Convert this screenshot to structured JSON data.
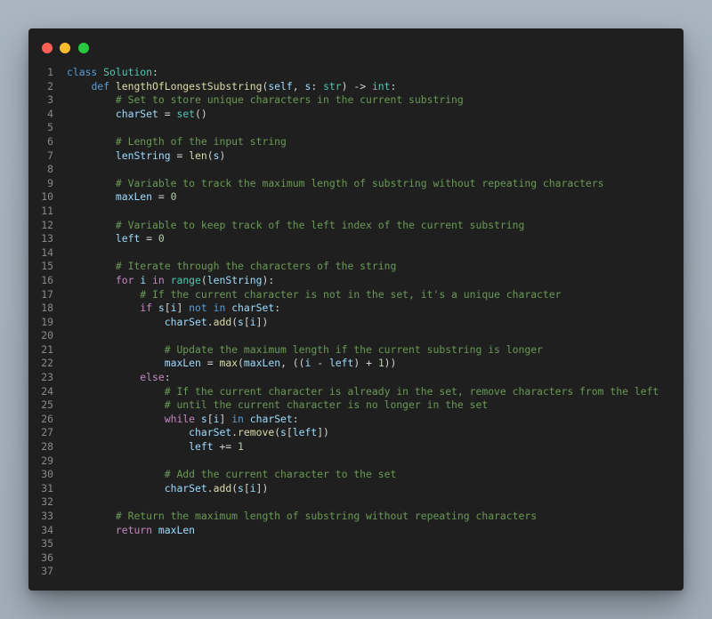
{
  "window": {
    "controls": [
      {
        "name": "close",
        "color": "#fe5f57"
      },
      {
        "name": "minimize",
        "color": "#febc2e"
      },
      {
        "name": "zoom",
        "color": "#28c840"
      }
    ]
  },
  "theme": {
    "default": "#d4d4d4",
    "kw": "#569cd6",
    "ctrl": "#c586c0",
    "cls": "#4ec9b0",
    "fn": "#dcdcaa",
    "var": "#9cdcfe",
    "num": "#b5cea8",
    "cmt": "#6a9955",
    "p": "#d4d4d4"
  },
  "code": {
    "lines": [
      [
        [
          "kw",
          "class"
        ],
        [
          "p",
          " "
        ],
        [
          "cls",
          "Solution"
        ],
        [
          "p",
          ":"
        ]
      ],
      [
        [
          "p",
          "    "
        ],
        [
          "kw",
          "def"
        ],
        [
          "p",
          " "
        ],
        [
          "fn",
          "lengthOfLongestSubstring"
        ],
        [
          "p",
          "("
        ],
        [
          "var",
          "self"
        ],
        [
          "p",
          ", "
        ],
        [
          "var",
          "s"
        ],
        [
          "p",
          ": "
        ],
        [
          "cls",
          "str"
        ],
        [
          "p",
          ") -> "
        ],
        [
          "cls",
          "int"
        ],
        [
          "p",
          ":"
        ]
      ],
      [
        [
          "p",
          "        "
        ],
        [
          "cmt",
          "# Set to store unique characters in the current substring"
        ]
      ],
      [
        [
          "p",
          "        "
        ],
        [
          "var",
          "charSet"
        ],
        [
          "p",
          " = "
        ],
        [
          "cls",
          "set"
        ],
        [
          "p",
          "()"
        ]
      ],
      [],
      [
        [
          "p",
          "        "
        ],
        [
          "cmt",
          "# Length of the input string"
        ]
      ],
      [
        [
          "p",
          "        "
        ],
        [
          "var",
          "lenString"
        ],
        [
          "p",
          " = "
        ],
        [
          "fn",
          "len"
        ],
        [
          "p",
          "("
        ],
        [
          "var",
          "s"
        ],
        [
          "p",
          ")"
        ]
      ],
      [],
      [
        [
          "p",
          "        "
        ],
        [
          "cmt",
          "# Variable to track the maximum length of substring without repeating characters"
        ]
      ],
      [
        [
          "p",
          "        "
        ],
        [
          "var",
          "maxLen"
        ],
        [
          "p",
          " = "
        ],
        [
          "num",
          "0"
        ]
      ],
      [],
      [
        [
          "p",
          "        "
        ],
        [
          "cmt",
          "# Variable to keep track of the left index of the current substring"
        ]
      ],
      [
        [
          "p",
          "        "
        ],
        [
          "var",
          "left"
        ],
        [
          "p",
          " = "
        ],
        [
          "num",
          "0"
        ]
      ],
      [],
      [
        [
          "p",
          "        "
        ],
        [
          "cmt",
          "# Iterate through the characters of the string"
        ]
      ],
      [
        [
          "p",
          "        "
        ],
        [
          "ctrl",
          "for"
        ],
        [
          "p",
          " "
        ],
        [
          "var",
          "i"
        ],
        [
          "p",
          " "
        ],
        [
          "ctrl",
          "in"
        ],
        [
          "p",
          " "
        ],
        [
          "cls",
          "range"
        ],
        [
          "p",
          "("
        ],
        [
          "var",
          "lenString"
        ],
        [
          "p",
          "):"
        ]
      ],
      [
        [
          "p",
          "            "
        ],
        [
          "cmt",
          "# If the current character is not in the set, it's a unique character"
        ]
      ],
      [
        [
          "p",
          "            "
        ],
        [
          "ctrl",
          "if"
        ],
        [
          "p",
          " "
        ],
        [
          "var",
          "s"
        ],
        [
          "p",
          "["
        ],
        [
          "var",
          "i"
        ],
        [
          "p",
          "] "
        ],
        [
          "kw",
          "not in"
        ],
        [
          "p",
          " "
        ],
        [
          "var",
          "charSet"
        ],
        [
          "p",
          ":"
        ]
      ],
      [
        [
          "p",
          "                "
        ],
        [
          "var",
          "charSet"
        ],
        [
          "p",
          "."
        ],
        [
          "fn",
          "add"
        ],
        [
          "p",
          "("
        ],
        [
          "var",
          "s"
        ],
        [
          "p",
          "["
        ],
        [
          "var",
          "i"
        ],
        [
          "p",
          "])"
        ]
      ],
      [],
      [
        [
          "p",
          "                "
        ],
        [
          "cmt",
          "# Update the maximum length if the current substring is longer"
        ]
      ],
      [
        [
          "p",
          "                "
        ],
        [
          "var",
          "maxLen"
        ],
        [
          "p",
          " = "
        ],
        [
          "fn",
          "max"
        ],
        [
          "p",
          "("
        ],
        [
          "var",
          "maxLen"
        ],
        [
          "p",
          ", (("
        ],
        [
          "var",
          "i"
        ],
        [
          "p",
          " - "
        ],
        [
          "var",
          "left"
        ],
        [
          "p",
          ") + "
        ],
        [
          "num",
          "1"
        ],
        [
          "p",
          "))"
        ]
      ],
      [
        [
          "p",
          "            "
        ],
        [
          "ctrl",
          "else"
        ],
        [
          "p",
          ":"
        ]
      ],
      [
        [
          "p",
          "                "
        ],
        [
          "cmt",
          "# If the current character is already in the set, remove characters from the left"
        ]
      ],
      [
        [
          "p",
          "                "
        ],
        [
          "cmt",
          "# until the current character is no longer in the set"
        ]
      ],
      [
        [
          "p",
          "                "
        ],
        [
          "ctrl",
          "while"
        ],
        [
          "p",
          " "
        ],
        [
          "var",
          "s"
        ],
        [
          "p",
          "["
        ],
        [
          "var",
          "i"
        ],
        [
          "p",
          "] "
        ],
        [
          "kw",
          "in"
        ],
        [
          "p",
          " "
        ],
        [
          "var",
          "charSet"
        ],
        [
          "p",
          ":"
        ]
      ],
      [
        [
          "p",
          "                    "
        ],
        [
          "var",
          "charSet"
        ],
        [
          "p",
          "."
        ],
        [
          "fn",
          "remove"
        ],
        [
          "p",
          "("
        ],
        [
          "var",
          "s"
        ],
        [
          "p",
          "["
        ],
        [
          "var",
          "left"
        ],
        [
          "p",
          "])"
        ]
      ],
      [
        [
          "p",
          "                    "
        ],
        [
          "var",
          "left"
        ],
        [
          "p",
          " += "
        ],
        [
          "num",
          "1"
        ]
      ],
      [],
      [
        [
          "p",
          "                "
        ],
        [
          "cmt",
          "# Add the current character to the set"
        ]
      ],
      [
        [
          "p",
          "                "
        ],
        [
          "var",
          "charSet"
        ],
        [
          "p",
          "."
        ],
        [
          "fn",
          "add"
        ],
        [
          "p",
          "("
        ],
        [
          "var",
          "s"
        ],
        [
          "p",
          "["
        ],
        [
          "var",
          "i"
        ],
        [
          "p",
          "])"
        ]
      ],
      [],
      [
        [
          "p",
          "        "
        ],
        [
          "cmt",
          "# Return the maximum length of substring without repeating characters"
        ]
      ],
      [
        [
          "p",
          "        "
        ],
        [
          "ctrl",
          "return"
        ],
        [
          "p",
          " "
        ],
        [
          "var",
          "maxLen"
        ]
      ],
      [],
      [],
      []
    ]
  }
}
